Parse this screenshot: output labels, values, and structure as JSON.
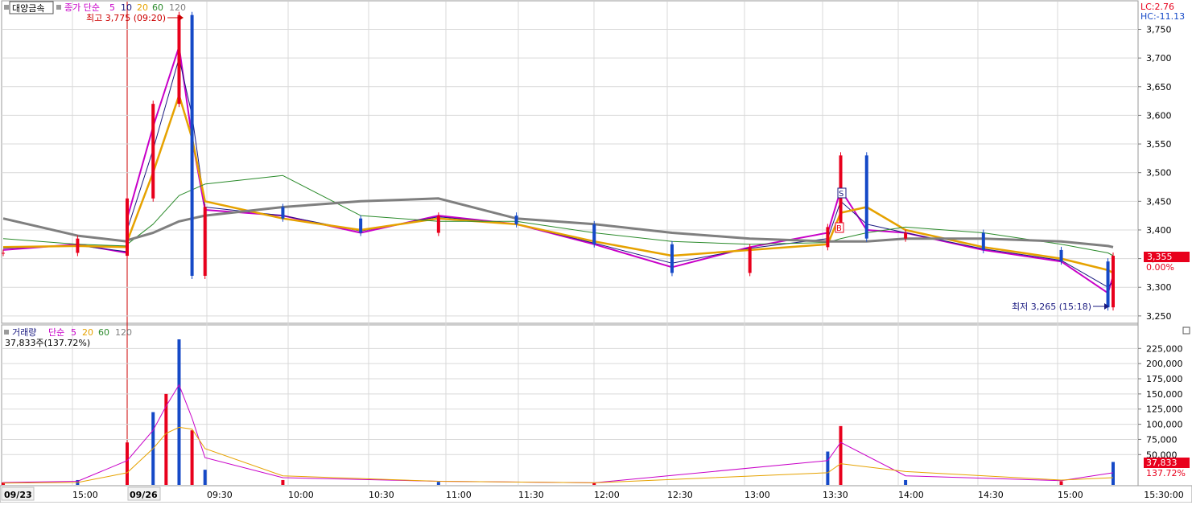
{
  "colors": {
    "up": "#e8001c",
    "down": "#1549c7",
    "ma5": "#c800c8",
    "ma10": "#1a1a80",
    "ma20": "#e6a200",
    "ma60": "#2a8a2a",
    "ma120": "#7f7f7f",
    "grid": "#d9d9d9",
    "last_badge": "#e8001c",
    "date_box": "#f2f2f2"
  },
  "price_panel": {
    "stock_name": "대양금속",
    "legend_prefix": "종가 단순",
    "ma_periods": [
      "5",
      "10",
      "20",
      "60",
      "120"
    ],
    "lc_label": "LC:2.76",
    "hc_label": "HC:-11.13",
    "high_label": "최고 3,775 (09:20)",
    "low_label": "최저 3,265 (15:18)",
    "last_price": "3,355",
    "last_change": "0.00%",
    "yticks": [
      "3,750",
      "3,700",
      "3,650",
      "3,600",
      "3,550",
      "3,500",
      "3,450",
      "3,400",
      "3,350",
      "3,300",
      "3,250"
    ],
    "signal_s": "S",
    "signal_b": "B"
  },
  "volume_panel": {
    "legend_label": "거래량",
    "legend_prefix": "단순",
    "ma_periods": [
      "5",
      "20",
      "60",
      "120"
    ],
    "current_label": "37,833주(137.72%)",
    "last_volume": "37,833",
    "last_ratio": "137.72%",
    "yticks": [
      "225,000",
      "200,000",
      "175,000",
      "150,000",
      "125,000",
      "100,000",
      "75,000",
      "50,000"
    ]
  },
  "x_axis": {
    "date_start": "09/23",
    "date_next": "09/26",
    "labels": [
      "15:00",
      "09:30",
      "10:00",
      "10:30",
      "11:00",
      "11:30",
      "12:00",
      "12:30",
      "13:00",
      "13:30",
      "14:00",
      "14:30",
      "15:00",
      "15:30:00"
    ]
  },
  "chart_data": [
    {
      "type": "candlestick",
      "title": "대양금속",
      "ylim": [
        3240,
        3790
      ],
      "x": [
        "09/23 14:30",
        "09/23 15:00",
        "09/23 15:20",
        "09/26 09:00",
        "09/26 09:10",
        "09/26 09:20",
        "09/26 09:25",
        "09/26 09:30",
        "09/26 10:00",
        "09/26 10:30",
        "09/26 11:00",
        "09/26 11:30",
        "09/26 12:00",
        "09/26 12:30",
        "09/26 13:00",
        "09/26 13:30",
        "09/26 13:35",
        "09/26 13:45",
        "09/26 14:00",
        "09/26 14:30",
        "09/26 15:00",
        "09/26 15:18",
        "09/26 15:20"
      ],
      "series": [
        {
          "name": "종가",
          "values": [
            3360,
            3385,
            3355,
            3455,
            3620,
            3775,
            3320,
            3440,
            3420,
            3395,
            3425,
            3410,
            3375,
            3325,
            3370,
            3405,
            3530,
            3385,
            3395,
            3365,
            3345,
            3265,
            3355
          ]
        },
        {
          "name": "5",
          "values": [
            3365,
            3375,
            3360,
            3420,
            3580,
            3720,
            3560,
            3435,
            3425,
            3395,
            3425,
            3410,
            3375,
            3335,
            3370,
            3395,
            3470,
            3400,
            3395,
            3365,
            3345,
            3290,
            3320
          ]
        },
        {
          "name": "10",
          "values": [
            3368,
            3373,
            3362,
            3400,
            3540,
            3700,
            3600,
            3440,
            3425,
            3398,
            3423,
            3410,
            3377,
            3342,
            3368,
            3385,
            3450,
            3410,
            3395,
            3367,
            3347,
            3300,
            3310
          ]
        },
        {
          "name": "20",
          "values": [
            3370,
            3372,
            3370,
            3380,
            3500,
            3635,
            3560,
            3450,
            3420,
            3400,
            3420,
            3410,
            3380,
            3355,
            3365,
            3375,
            3430,
            3440,
            3400,
            3370,
            3350,
            3330,
            3325
          ]
        },
        {
          "name": "60",
          "values": [
            3385,
            3375,
            3372,
            3375,
            3410,
            3460,
            3470,
            3480,
            3495,
            3425,
            3415,
            3415,
            3395,
            3380,
            3375,
            3378,
            3385,
            3395,
            3405,
            3395,
            3375,
            3360,
            3355
          ]
        },
        {
          "name": "120",
          "values": [
            3420,
            3390,
            3380,
            3382,
            3395,
            3415,
            3420,
            3425,
            3440,
            3450,
            3455,
            3420,
            3410,
            3395,
            3385,
            3380,
            3380,
            3380,
            3385,
            3385,
            3380,
            3372,
            3370
          ]
        }
      ]
    },
    {
      "type": "bar",
      "title": "거래량",
      "ylim": [
        0,
        240000
      ],
      "x": [
        "09/23 14:30",
        "09/23 15:00",
        "09/26 09:00",
        "09/26 09:10",
        "09/26 09:15",
        "09/26 09:20",
        "09/26 09:25",
        "09/26 09:30",
        "09/26 10:00",
        "09/26 11:00",
        "09/26 12:00",
        "09/26 13:30",
        "09/26 13:35",
        "09/26 14:00",
        "09/26 15:00",
        "09/26 15:20"
      ],
      "series": [
        {
          "name": "거래량",
          "values": [
            4000,
            8000,
            70000,
            120000,
            150000,
            240000,
            90000,
            25000,
            8000,
            5000,
            3000,
            55000,
            97000,
            8000,
            6000,
            37833
          ]
        },
        {
          "name": "5",
          "values": [
            4000,
            6000,
            40000,
            90000,
            130000,
            165000,
            110000,
            45000,
            12000,
            6000,
            3500,
            40000,
            70000,
            15000,
            7000,
            20000
          ]
        },
        {
          "name": "20",
          "values": [
            3000,
            4000,
            20000,
            60000,
            85000,
            95000,
            92000,
            60000,
            15000,
            6000,
            3500,
            20000,
            35000,
            22000,
            8000,
            12000
          ]
        }
      ]
    }
  ]
}
